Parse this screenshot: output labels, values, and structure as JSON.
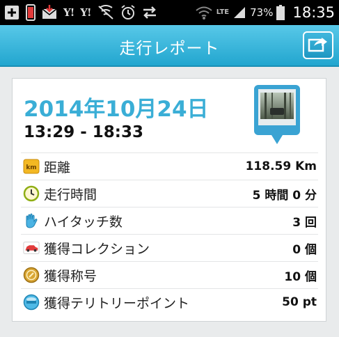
{
  "status_bar": {
    "battery_percent": "73%",
    "time": "18:35",
    "network": "LTE"
  },
  "header": {
    "title": "走行レポート",
    "share_icon": "share-icon"
  },
  "report": {
    "date": "2014年10月24日",
    "time_range": "13:29 - 18:33",
    "accent_color": "#3aaed6",
    "stats": [
      {
        "label": "距離",
        "value": "118.59 Km",
        "icon": "km-badge-icon"
      },
      {
        "label": "走行時間",
        "value": "5 時間 0 分",
        "icon": "clock-icon"
      },
      {
        "label": "ハイタッチ数",
        "value": "3 回",
        "icon": "hand-icon"
      },
      {
        "label": "獲得コレクション",
        "value": "0 個",
        "icon": "car-icon"
      },
      {
        "label": "獲得称号",
        "value": "10 個",
        "icon": "medal-icon"
      },
      {
        "label": "獲得テリトリーポイント",
        "value": "50 pt",
        "icon": "spot-icon"
      }
    ]
  }
}
